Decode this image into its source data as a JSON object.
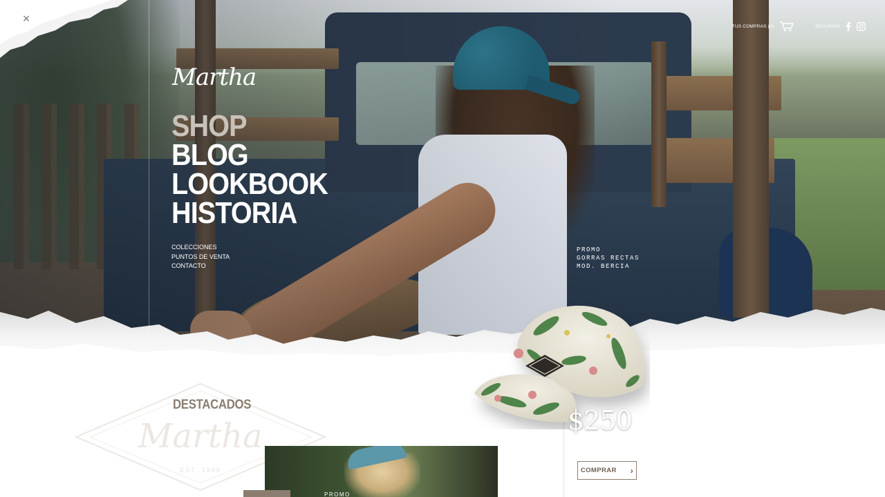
{
  "brand": {
    "logo": "Martha"
  },
  "close": {
    "symbol": "×"
  },
  "nav": {
    "main": [
      {
        "label": "SHOP",
        "active": true
      },
      {
        "label": "BLOG",
        "active": false
      },
      {
        "label": "LOOKBOOK",
        "active": false
      },
      {
        "label": "HISTORIA",
        "active": false
      }
    ],
    "secondary": [
      "COLECCIONES",
      "PUNTOS DE VENTA",
      "CONTACTO"
    ]
  },
  "topbar": {
    "cart_label": "TUS COMPRAS (0)",
    "social_label": "SEGUINOS",
    "icons": [
      "cart-icon",
      "facebook-icon",
      "instagram-icon"
    ]
  },
  "promo": {
    "line1": "PROMO",
    "line2": "GORRAS RECTAS",
    "line3": "MOD. BERCIA"
  },
  "product": {
    "price": "$250",
    "buy_label": "COMPRAR"
  },
  "featured": {
    "heading": "DESTACADOS",
    "card_label": "PROMO",
    "watermark_text": "Martha",
    "watermark_sub": "EST. 1999"
  },
  "colors": {
    "accent": "#8a7d70",
    "nav_active": "#c9c2ba",
    "button_border": "#8c7e70"
  }
}
